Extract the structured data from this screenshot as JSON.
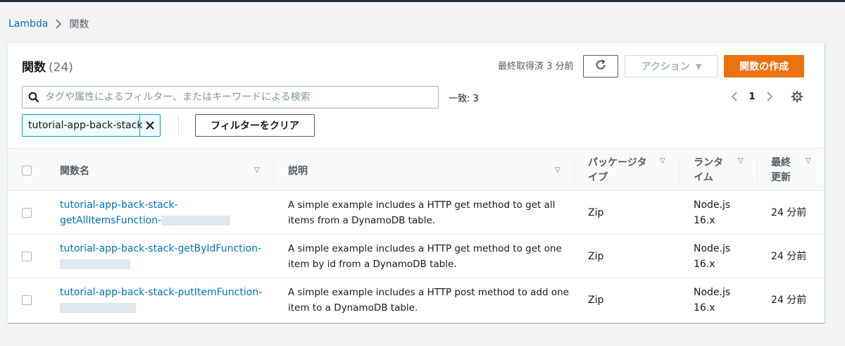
{
  "breadcrumb": {
    "root": "Lambda",
    "current": "関数"
  },
  "panel": {
    "title": "関数",
    "count": "(24)",
    "last_fetched": "最終取得済 3 分前",
    "actions_label": "アクション",
    "create_label": "関数の作成",
    "search_placeholder": "タグや属性によるフィルター、またはキーワードによる検索",
    "match_text": "一致: 3",
    "page_number": "1",
    "filter_token": "tutorial-app-back-stack",
    "clear_filter_label": "フィルターをクリア"
  },
  "table": {
    "headers": {
      "name": "関数名",
      "description": "説明",
      "package_type_line1": "パッケージタ",
      "package_type_line2": "イプ",
      "runtime_line1": "ランタ",
      "runtime_line2": "イム",
      "modified_line1": "最終",
      "modified_line2": "更新"
    },
    "rows": [
      {
        "name_line1": "tutorial-app-back-stack-",
        "name_line2": "getAllItemsFunction-",
        "description_line1": "A simple example includes a HTTP get method to get all",
        "description_line2": "items from a DynamoDB table.",
        "package_type": "Zip",
        "runtime_line1": "Node.js",
        "runtime_line2": "16.x",
        "last_modified": "24 分前"
      },
      {
        "name_line1": "tutorial-app-back-stack-getByIdFunction-",
        "name_line2": "",
        "description_line1": "A simple example includes a HTTP get method to get one",
        "description_line2": "item by id from a DynamoDB table.",
        "package_type": "Zip",
        "runtime_line1": "Node.js",
        "runtime_line2": "16.x",
        "last_modified": "24 分前"
      },
      {
        "name_line1": "tutorial-app-back-stack-putItemFunction-",
        "name_line2": "",
        "description_line1": "A simple example includes a HTTP post method to add one",
        "description_line2": "item to a DynamoDB table.",
        "package_type": "Zip",
        "runtime_line1": "Node.js",
        "runtime_line2": "16.x",
        "last_modified": "24 分前"
      }
    ]
  },
  "colors": {
    "link": "#0073bb",
    "primary_button": "#ec7211",
    "token_border": "#00a1c9",
    "background": "#f2f3f3"
  },
  "icons": [
    "chevron-right-icon",
    "refresh-icon",
    "caret-down-icon",
    "search-icon",
    "chevron-left-icon",
    "settings-gear-icon",
    "close-icon",
    "sort-caret-icon"
  ]
}
